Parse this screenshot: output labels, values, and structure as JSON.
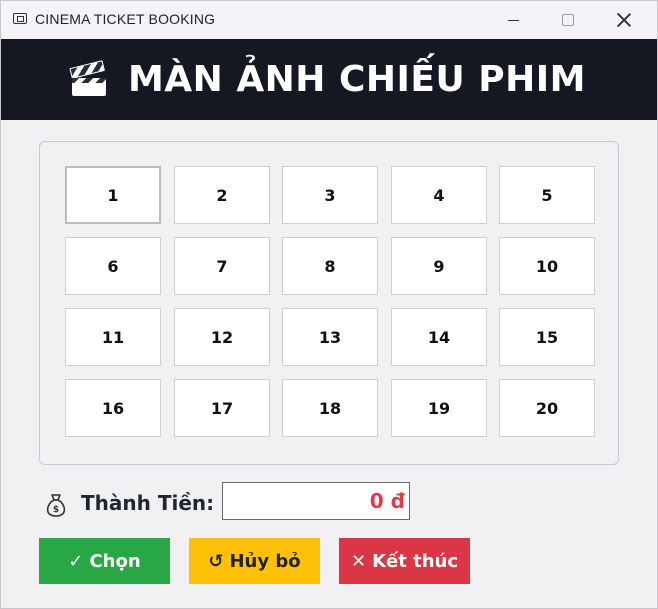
{
  "window": {
    "title": "CINEMA TICKET BOOKING"
  },
  "header": {
    "title": "MÀN ẢNH CHIẾU PHIM",
    "icon": "clapperboard-icon"
  },
  "seats": [
    "1",
    "2",
    "3",
    "4",
    "5",
    "6",
    "7",
    "8",
    "9",
    "10",
    "11",
    "12",
    "13",
    "14",
    "15",
    "16",
    "17",
    "18",
    "19",
    "20"
  ],
  "selected_seat": "1",
  "total": {
    "label": "Thành Tiền:",
    "value": "0 đ",
    "icon": "money-bag-icon",
    "value_color": "#e23a4b"
  },
  "buttons": {
    "choose_label": "Chọn",
    "choose_glyph": "✓",
    "cancel_label": "Hủy bỏ",
    "cancel_glyph": "↺",
    "exit_label": "Kết thúc",
    "exit_glyph": "✕"
  },
  "colors": {
    "header_bg": "#151823",
    "choose": "#28a745",
    "cancel": "#ffc107",
    "exit": "#dc3545"
  }
}
